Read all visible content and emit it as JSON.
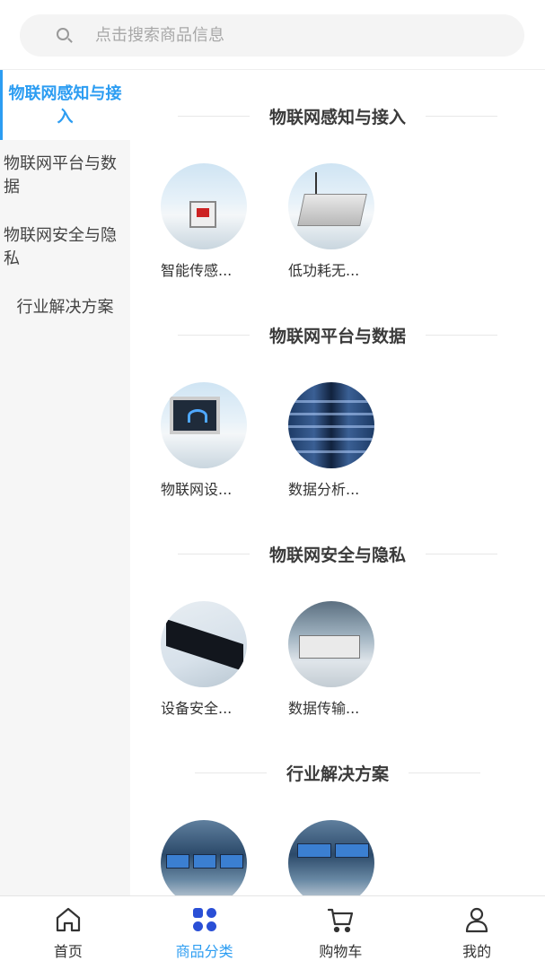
{
  "search": {
    "placeholder": "点击搜索商品信息"
  },
  "sidebar": {
    "items": [
      {
        "label": "物联网感知与接入",
        "active": true
      },
      {
        "label": "物联网平台与数据",
        "active": false
      },
      {
        "label": "物联网安全与隐私",
        "active": false
      },
      {
        "label": "行业解决方案",
        "active": false
      }
    ]
  },
  "sections": [
    {
      "title": "物联网感知与接入",
      "products": [
        {
          "name": "智能传感..."
        },
        {
          "name": "低功耗无..."
        }
      ]
    },
    {
      "title": "物联网平台与数据",
      "products": [
        {
          "name": "物联网设..."
        },
        {
          "name": "数据分析..."
        }
      ]
    },
    {
      "title": "物联网安全与隐私",
      "products": [
        {
          "name": "设备安全..."
        },
        {
          "name": "数据传输..."
        }
      ]
    },
    {
      "title": "行业解决方案",
      "products": [
        {
          "name": ""
        },
        {
          "name": ""
        }
      ]
    }
  ],
  "tabbar": {
    "items": [
      {
        "label": "首页",
        "icon": "home-icon",
        "active": false
      },
      {
        "label": "商品分类",
        "icon": "category-icon",
        "active": true
      },
      {
        "label": "购物车",
        "icon": "cart-icon",
        "active": false
      },
      {
        "label": "我的",
        "icon": "user-icon",
        "active": false
      }
    ]
  },
  "colors": {
    "accent": "#2c9df2",
    "active_tab_icon": "#2a4fd6"
  }
}
